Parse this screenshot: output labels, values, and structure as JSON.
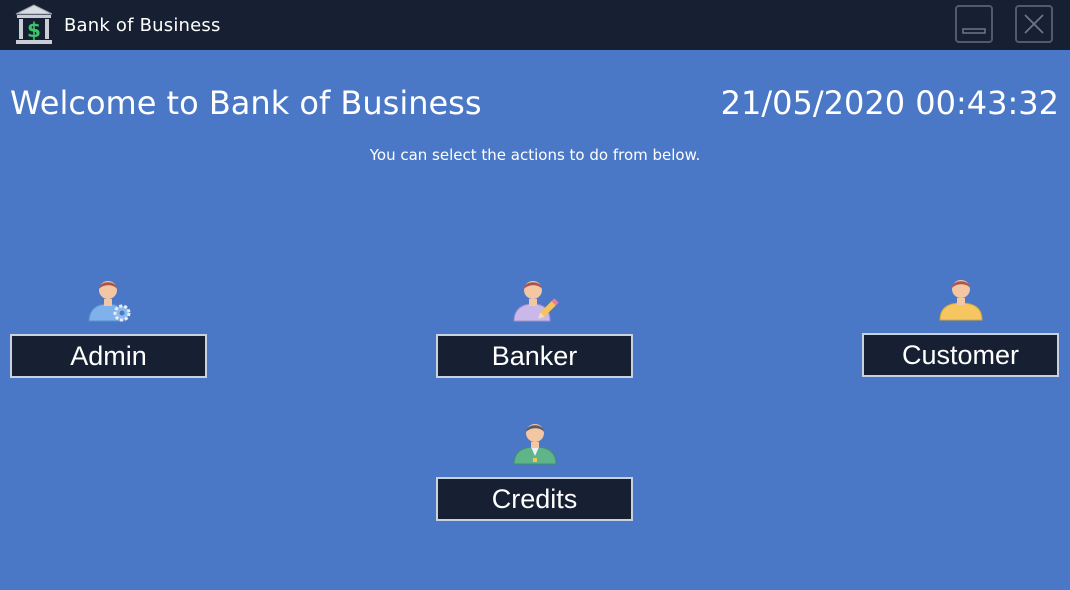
{
  "window": {
    "title": "Bank of Business",
    "logo_icon": "bank-dollar-icon",
    "minimize_icon": "minimize-icon",
    "close_icon": "close-icon"
  },
  "header": {
    "welcome": "Welcome to Bank of Business",
    "datetime": "21/05/2020 00:43:32",
    "subtitle": "You can select the actions to do from below."
  },
  "roles": [
    {
      "label": "Admin",
      "icon": "admin-gear-icon"
    },
    {
      "label": "Banker",
      "icon": "banker-pencil-icon"
    },
    {
      "label": "Customer",
      "icon": "customer-icon"
    },
    {
      "label": "Credits",
      "icon": "credits-icon"
    }
  ],
  "colors": {
    "background": "#4a78c6",
    "titlebar": "#172032",
    "button": "#172032",
    "button_border": "#c9d1de"
  }
}
